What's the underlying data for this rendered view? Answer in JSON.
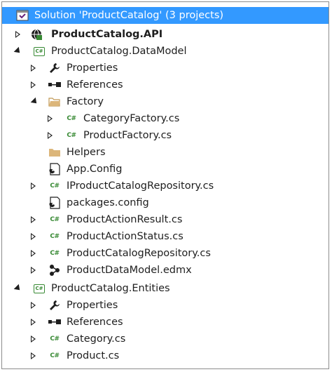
{
  "solution": {
    "label": "Solution 'ProductCatalog' (3 projects)"
  },
  "tree": {
    "api": {
      "label": "ProductCatalog.API"
    },
    "datamodel": {
      "label": "ProductCatalog.DataModel",
      "properties": "Properties",
      "references": "References",
      "factory": {
        "label": "Factory",
        "category_factory": "CategoryFactory.cs",
        "product_factory": "ProductFactory.cs"
      },
      "helpers": "Helpers",
      "app_config": "App.Config",
      "repo_interface": "IProductCatalogRepository.cs",
      "packages_config": "packages.config",
      "action_result": "ProductActionResult.cs",
      "action_status": "ProductActionStatus.cs",
      "repository": "ProductCatalogRepository.cs",
      "edmx": "ProductDataModel.edmx"
    },
    "entities": {
      "label": "ProductCatalog.Entities",
      "properties": "Properties",
      "references": "References",
      "category": "Category.cs",
      "product": "Product.cs"
    }
  },
  "icons": {
    "cs_badge": "C#",
    "project_badge": "C#"
  },
  "colors": {
    "selection": "#3399ff",
    "cs_green": "#388a34",
    "folder": "#dcb67a",
    "vs_purple": "#68217a"
  }
}
